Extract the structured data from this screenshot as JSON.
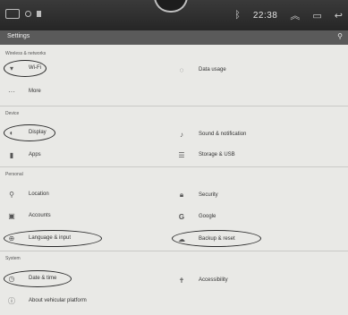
{
  "status_bar": {
    "time": "22:38",
    "icons": [
      "window-icon",
      "signal-icon",
      "notification-icon",
      "bluetooth-icon",
      "expand-icon",
      "recent-apps-icon",
      "back-icon"
    ]
  },
  "app_bar": {
    "title": "Settings",
    "search_icon": "search-icon"
  },
  "sections": {
    "wireless": {
      "header": "Wireless & networks",
      "wifi": "Wi-Fi",
      "data_usage": "Data usage",
      "more": "More"
    },
    "device": {
      "header": "Device",
      "display": "Display",
      "sound": "Sound & notification",
      "apps": "Apps",
      "storage": "Storage & USB"
    },
    "personal": {
      "header": "Personal",
      "location": "Location",
      "security": "Security",
      "accounts": "Accounts",
      "google": "Google",
      "language": "Language & input",
      "backup": "Backup & reset"
    },
    "system": {
      "header": "System",
      "date_time": "Date & time",
      "accessibility": "Accessibility",
      "about": "About vehicular platform"
    }
  },
  "annotation_color": "#2b2b2b"
}
